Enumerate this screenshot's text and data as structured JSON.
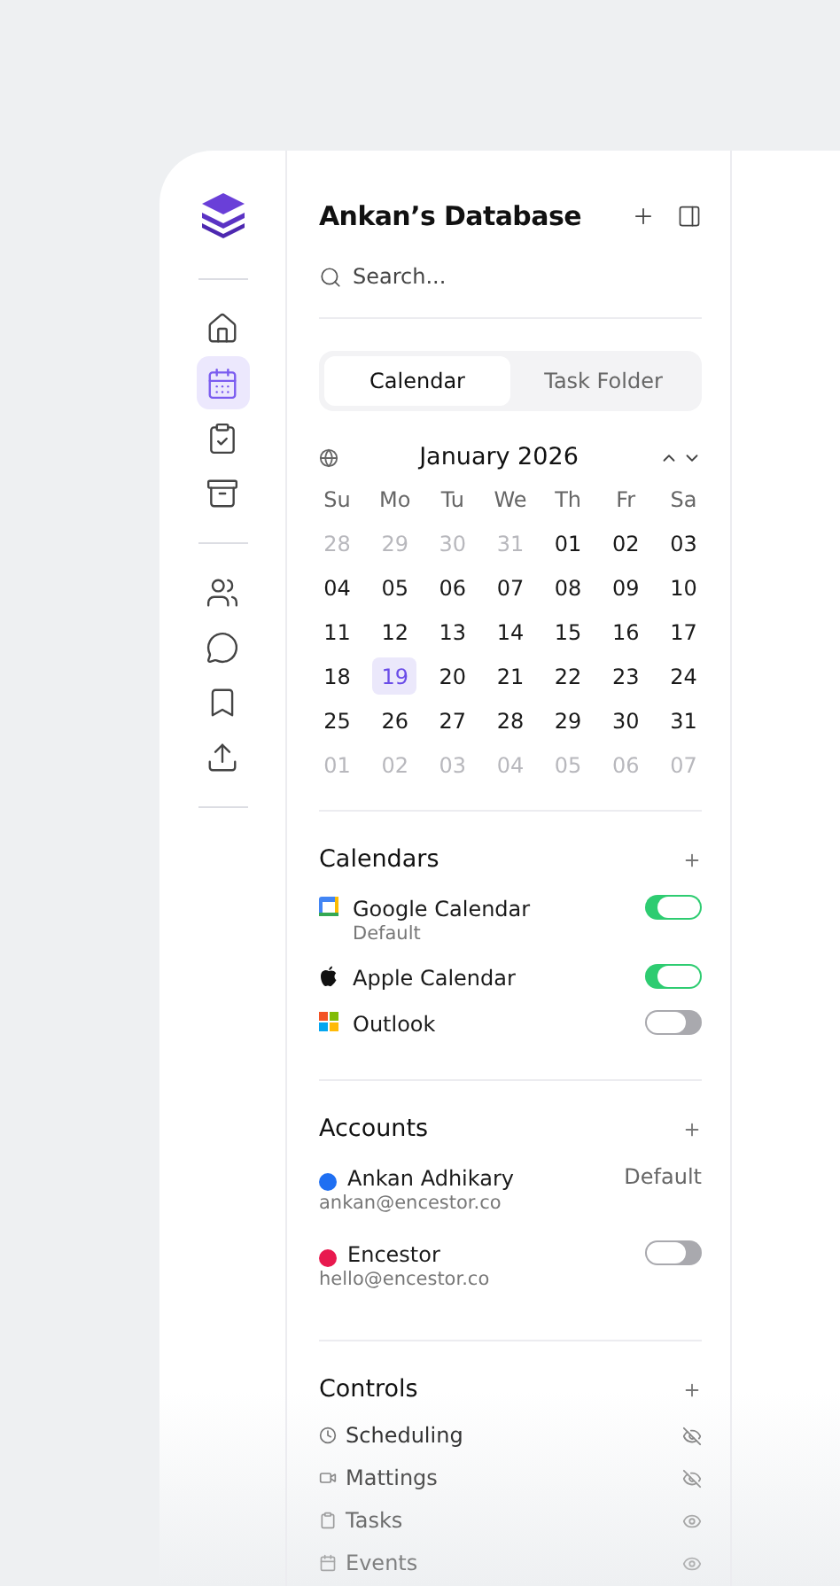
{
  "rail_groups": [
    [
      {
        "selected": false
      },
      {
        "selected": true
      },
      {
        "selected": false
      },
      {
        "selected": false
      }
    ],
    [
      {
        "selected": false
      },
      {
        "selected": false
      },
      {
        "selected": false
      },
      {
        "selected": false
      }
    ]
  ],
  "title": "Ankan’s Database",
  "search": {
    "placeholder": "Search..."
  },
  "tabs": [
    {
      "label": "Calendar",
      "selected": true
    },
    {
      "label": "Task Folder",
      "selected": false
    }
  ],
  "calendar": {
    "month": "January 2026",
    "weekdays": [
      "Su",
      "Mo",
      "Tu",
      "We",
      "Th",
      "Fr",
      "Sa"
    ],
    "weeks": [
      [
        {
          "d": "28",
          "muted": true,
          "selected": false
        },
        {
          "d": "29",
          "muted": true,
          "selected": false
        },
        {
          "d": "30",
          "muted": true,
          "selected": false
        },
        {
          "d": "31",
          "muted": true,
          "selected": false
        },
        {
          "d": "01",
          "muted": false,
          "selected": false
        },
        {
          "d": "02",
          "muted": false,
          "selected": false
        },
        {
          "d": "03",
          "muted": false,
          "selected": false
        }
      ],
      [
        {
          "d": "04",
          "muted": false,
          "selected": false
        },
        {
          "d": "05",
          "muted": false,
          "selected": false
        },
        {
          "d": "06",
          "muted": false,
          "selected": false
        },
        {
          "d": "07",
          "muted": false,
          "selected": false
        },
        {
          "d": "08",
          "muted": false,
          "selected": false
        },
        {
          "d": "09",
          "muted": false,
          "selected": false
        },
        {
          "d": "10",
          "muted": false,
          "selected": false
        }
      ],
      [
        {
          "d": "11",
          "muted": false,
          "selected": false
        },
        {
          "d": "12",
          "muted": false,
          "selected": false
        },
        {
          "d": "13",
          "muted": false,
          "selected": false
        },
        {
          "d": "14",
          "muted": false,
          "selected": false
        },
        {
          "d": "15",
          "muted": false,
          "selected": false
        },
        {
          "d": "16",
          "muted": false,
          "selected": false
        },
        {
          "d": "17",
          "muted": false,
          "selected": false
        }
      ],
      [
        {
          "d": "18",
          "muted": false,
          "selected": false
        },
        {
          "d": "19",
          "muted": false,
          "selected": true
        },
        {
          "d": "20",
          "muted": false,
          "selected": false
        },
        {
          "d": "21",
          "muted": false,
          "selected": false
        },
        {
          "d": "22",
          "muted": false,
          "selected": false
        },
        {
          "d": "23",
          "muted": false,
          "selected": false
        },
        {
          "d": "24",
          "muted": false,
          "selected": false
        }
      ],
      [
        {
          "d": "25",
          "muted": false,
          "selected": false
        },
        {
          "d": "26",
          "muted": false,
          "selected": false
        },
        {
          "d": "27",
          "muted": false,
          "selected": false
        },
        {
          "d": "28",
          "muted": false,
          "selected": false
        },
        {
          "d": "29",
          "muted": false,
          "selected": false
        },
        {
          "d": "30",
          "muted": false,
          "selected": false
        },
        {
          "d": "31",
          "muted": false,
          "selected": false
        }
      ],
      [
        {
          "d": "01",
          "muted": true,
          "selected": false
        },
        {
          "d": "02",
          "muted": true,
          "selected": false
        },
        {
          "d": "03",
          "muted": true,
          "selected": false
        },
        {
          "d": "04",
          "muted": true,
          "selected": false
        },
        {
          "d": "05",
          "muted": true,
          "selected": false
        },
        {
          "d": "06",
          "muted": true,
          "selected": false
        },
        {
          "d": "07",
          "muted": true,
          "selected": false
        }
      ]
    ]
  },
  "calendars": {
    "title": "Calendars",
    "items": [
      {
        "kind": "google",
        "name": "Google Calendar",
        "note": "Default",
        "on": true
      },
      {
        "kind": "apple",
        "name": "Apple Calendar",
        "on": true
      },
      {
        "kind": "windows",
        "name": "Outlook",
        "on": false
      }
    ]
  },
  "accounts": {
    "title": "Accounts",
    "items": [
      {
        "name": "Ankan Adhikary",
        "email": "ankan@encestor.co",
        "color": "#1f6ff2",
        "kind": "label",
        "label": "Default"
      },
      {
        "name": "Encestor",
        "email": "hello@encestor.co",
        "color": "#e8194e",
        "kind": "toggle",
        "on": false
      }
    ]
  },
  "controls": {
    "title": "Controls",
    "items": [
      {
        "kind": "clock",
        "label": "Scheduling",
        "visible": false
      },
      {
        "kind": "video",
        "label": "Mattings",
        "visible": false
      },
      {
        "kind": "clipboard",
        "label": "Tasks",
        "visible": true
      },
      {
        "kind": "calendar",
        "label": "Events",
        "visible": true
      }
    ]
  }
}
